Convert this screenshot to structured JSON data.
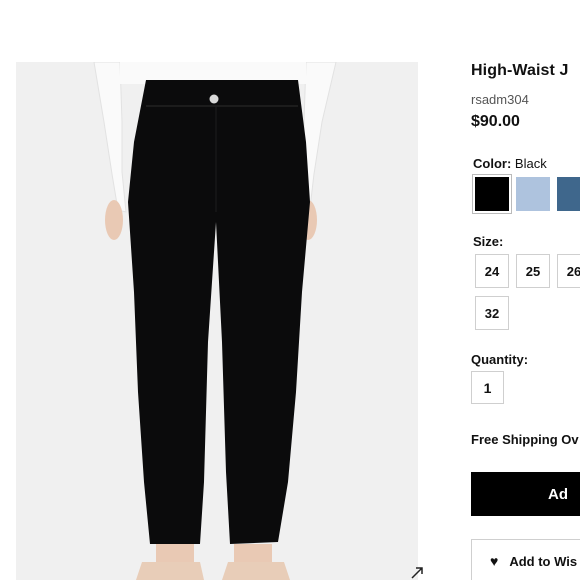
{
  "product": {
    "title": "High-Waist J",
    "sku": "rsadm304",
    "price": "$90.00"
  },
  "color": {
    "label": "Color:",
    "selected": "Black",
    "swatches": [
      {
        "name": "Black",
        "hex": "#000000"
      },
      {
        "name": "Light Blue",
        "hex": "#aec3de"
      },
      {
        "name": "Blue",
        "hex": "#3f678c"
      }
    ]
  },
  "size": {
    "label": "Size:",
    "options": [
      "24",
      "25",
      "26",
      "32"
    ]
  },
  "quantity": {
    "label": "Quantity:",
    "value": "1"
  },
  "shipping_text": "Free Shipping Ov",
  "buttons": {
    "add_label": "Ad",
    "wishlist_label": "Add to Wis",
    "wishlist_icon": "heart-icon"
  },
  "photo": {
    "expand_icon": "expand-icon"
  }
}
